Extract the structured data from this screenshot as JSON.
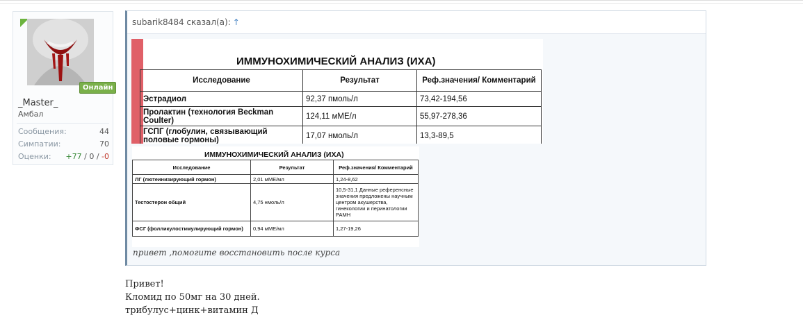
{
  "user": {
    "name": "_Master_",
    "title": "Амбал",
    "online_badge": "Онлайн",
    "stats": {
      "messages_label": "Сообщения:",
      "messages_value": "44",
      "likes_label": "Симпатии:",
      "likes_value": "70",
      "ratings_label": "Оценки:",
      "ratings_pos": "+77",
      "ratings_sep1": " / ",
      "ratings_zero": "0",
      "ratings_sep2": " / ",
      "ratings_neg": "-0"
    }
  },
  "quote": {
    "author_said": "subarik8484 сказал(а):",
    "arrow": "↑",
    "text": "привет ,помогите восстановить после курса"
  },
  "scan1": {
    "title": "ИММУНОХИМИЧЕСКИЙ АНАЛИЗ (ИХА)",
    "headers": [
      "Исследование",
      "Результат",
      "Реф.значения/ Комментарий"
    ],
    "rows": [
      [
        "Эстрадиол",
        "92,37 пмоль/л",
        "73,42-194,56"
      ],
      [
        "Пролактин (технология Beckman Coulter)",
        "124,11 мМЕ/л",
        "55,97-278,36"
      ],
      [
        "ГСПГ (глобулин, связывающий половые гормоны)",
        "17,07 нмоль/л",
        "13,3-89,5"
      ]
    ]
  },
  "scan2": {
    "title": "ИММУНОХИМИЧЕСКИЙ АНАЛИЗ (ИХА)",
    "headers": [
      "Исследование",
      "Результат",
      "Реф.значения/ Комментарий"
    ],
    "rows": [
      [
        "ЛГ (лютеинизирующий гормон)",
        "2,01 мМЕ/мл",
        "1,24-8,62"
      ],
      [
        "Тестостерон общий",
        "4,75 нмоль/л",
        "10,5-31,1 Данные референсные значения предложены научным центром акушерства, гинекологии и перинатологии РАМН"
      ],
      [
        "ФСГ (фолликулостимулирующий гормон)",
        "0,94 мМЕ/мл",
        "1,27-19,26"
      ]
    ]
  },
  "message": {
    "line1": "Привет!",
    "line2": "Кломид по 50мг на 30 дней.",
    "line3": "трибулус+цинк+витамин Д"
  }
}
